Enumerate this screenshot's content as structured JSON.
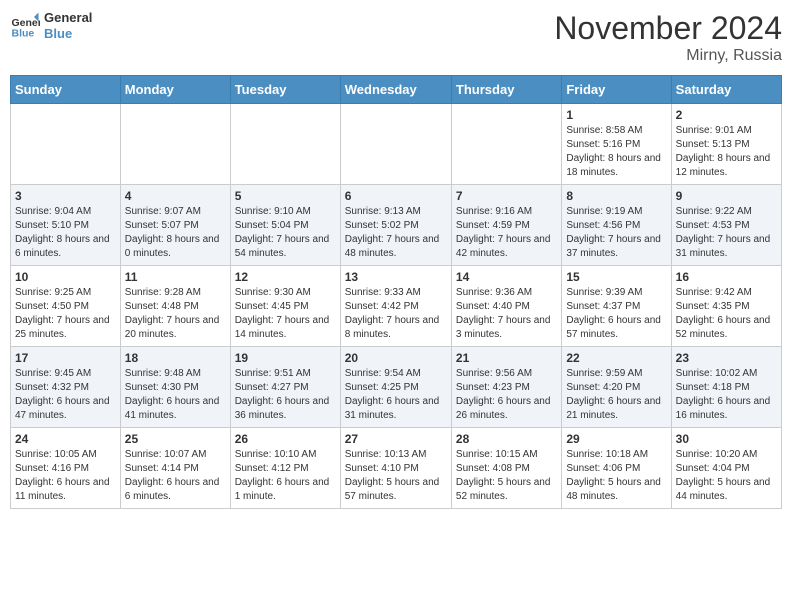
{
  "header": {
    "logo_general": "General",
    "logo_blue": "Blue",
    "title": "November 2024",
    "subtitle": "Mirny, Russia"
  },
  "weekdays": [
    "Sunday",
    "Monday",
    "Tuesday",
    "Wednesday",
    "Thursday",
    "Friday",
    "Saturday"
  ],
  "weeks": [
    [
      {
        "day": "",
        "info": ""
      },
      {
        "day": "",
        "info": ""
      },
      {
        "day": "",
        "info": ""
      },
      {
        "day": "",
        "info": ""
      },
      {
        "day": "",
        "info": ""
      },
      {
        "day": "1",
        "info": "Sunrise: 8:58 AM\nSunset: 5:16 PM\nDaylight: 8 hours and 18 minutes."
      },
      {
        "day": "2",
        "info": "Sunrise: 9:01 AM\nSunset: 5:13 PM\nDaylight: 8 hours and 12 minutes."
      }
    ],
    [
      {
        "day": "3",
        "info": "Sunrise: 9:04 AM\nSunset: 5:10 PM\nDaylight: 8 hours and 6 minutes."
      },
      {
        "day": "4",
        "info": "Sunrise: 9:07 AM\nSunset: 5:07 PM\nDaylight: 8 hours and 0 minutes."
      },
      {
        "day": "5",
        "info": "Sunrise: 9:10 AM\nSunset: 5:04 PM\nDaylight: 7 hours and 54 minutes."
      },
      {
        "day": "6",
        "info": "Sunrise: 9:13 AM\nSunset: 5:02 PM\nDaylight: 7 hours and 48 minutes."
      },
      {
        "day": "7",
        "info": "Sunrise: 9:16 AM\nSunset: 4:59 PM\nDaylight: 7 hours and 42 minutes."
      },
      {
        "day": "8",
        "info": "Sunrise: 9:19 AM\nSunset: 4:56 PM\nDaylight: 7 hours and 37 minutes."
      },
      {
        "day": "9",
        "info": "Sunrise: 9:22 AM\nSunset: 4:53 PM\nDaylight: 7 hours and 31 minutes."
      }
    ],
    [
      {
        "day": "10",
        "info": "Sunrise: 9:25 AM\nSunset: 4:50 PM\nDaylight: 7 hours and 25 minutes."
      },
      {
        "day": "11",
        "info": "Sunrise: 9:28 AM\nSunset: 4:48 PM\nDaylight: 7 hours and 20 minutes."
      },
      {
        "day": "12",
        "info": "Sunrise: 9:30 AM\nSunset: 4:45 PM\nDaylight: 7 hours and 14 minutes."
      },
      {
        "day": "13",
        "info": "Sunrise: 9:33 AM\nSunset: 4:42 PM\nDaylight: 7 hours and 8 minutes."
      },
      {
        "day": "14",
        "info": "Sunrise: 9:36 AM\nSunset: 4:40 PM\nDaylight: 7 hours and 3 minutes."
      },
      {
        "day": "15",
        "info": "Sunrise: 9:39 AM\nSunset: 4:37 PM\nDaylight: 6 hours and 57 minutes."
      },
      {
        "day": "16",
        "info": "Sunrise: 9:42 AM\nSunset: 4:35 PM\nDaylight: 6 hours and 52 minutes."
      }
    ],
    [
      {
        "day": "17",
        "info": "Sunrise: 9:45 AM\nSunset: 4:32 PM\nDaylight: 6 hours and 47 minutes."
      },
      {
        "day": "18",
        "info": "Sunrise: 9:48 AM\nSunset: 4:30 PM\nDaylight: 6 hours and 41 minutes."
      },
      {
        "day": "19",
        "info": "Sunrise: 9:51 AM\nSunset: 4:27 PM\nDaylight: 6 hours and 36 minutes."
      },
      {
        "day": "20",
        "info": "Sunrise: 9:54 AM\nSunset: 4:25 PM\nDaylight: 6 hours and 31 minutes."
      },
      {
        "day": "21",
        "info": "Sunrise: 9:56 AM\nSunset: 4:23 PM\nDaylight: 6 hours and 26 minutes."
      },
      {
        "day": "22",
        "info": "Sunrise: 9:59 AM\nSunset: 4:20 PM\nDaylight: 6 hours and 21 minutes."
      },
      {
        "day": "23",
        "info": "Sunrise: 10:02 AM\nSunset: 4:18 PM\nDaylight: 6 hours and 16 minutes."
      }
    ],
    [
      {
        "day": "24",
        "info": "Sunrise: 10:05 AM\nSunset: 4:16 PM\nDaylight: 6 hours and 11 minutes."
      },
      {
        "day": "25",
        "info": "Sunrise: 10:07 AM\nSunset: 4:14 PM\nDaylight: 6 hours and 6 minutes."
      },
      {
        "day": "26",
        "info": "Sunrise: 10:10 AM\nSunset: 4:12 PM\nDaylight: 6 hours and 1 minute."
      },
      {
        "day": "27",
        "info": "Sunrise: 10:13 AM\nSunset: 4:10 PM\nDaylight: 5 hours and 57 minutes."
      },
      {
        "day": "28",
        "info": "Sunrise: 10:15 AM\nSunset: 4:08 PM\nDaylight: 5 hours and 52 minutes."
      },
      {
        "day": "29",
        "info": "Sunrise: 10:18 AM\nSunset: 4:06 PM\nDaylight: 5 hours and 48 minutes."
      },
      {
        "day": "30",
        "info": "Sunrise: 10:20 AM\nSunset: 4:04 PM\nDaylight: 5 hours and 44 minutes."
      }
    ]
  ]
}
